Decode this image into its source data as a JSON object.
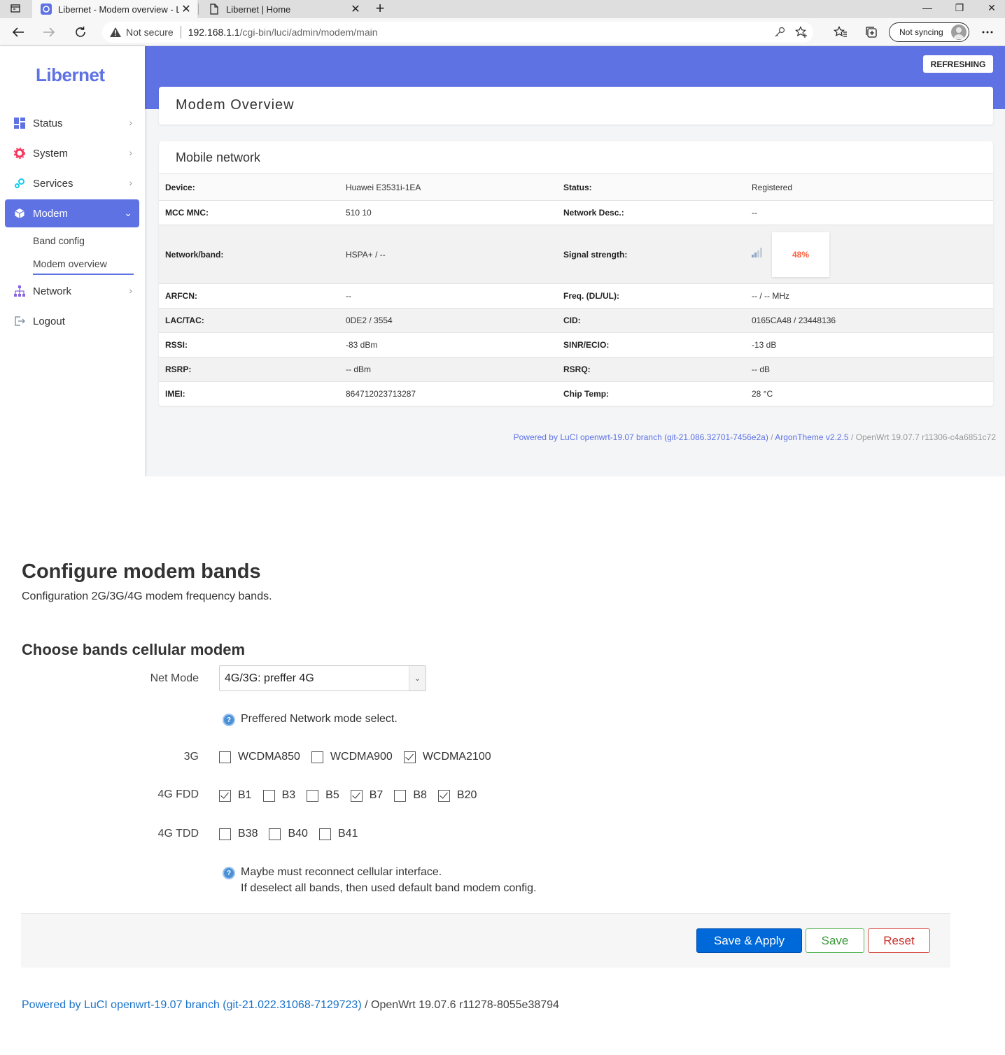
{
  "browser": {
    "tabs": [
      {
        "title": "Libernet - Modem overview - LuCI",
        "active": true
      },
      {
        "title": "Libernet | Home",
        "active": false
      }
    ],
    "address": {
      "security_label": "Not secure",
      "host": "192.168.1.1",
      "path": "/cgi-bin/luci/admin/modem/main"
    },
    "sync_label": "Not syncing"
  },
  "argon": {
    "brand": "Libernet",
    "refresh_label": "REFRESHING",
    "nav": [
      {
        "label": "Status",
        "icon": "dashboard-icon"
      },
      {
        "label": "System",
        "icon": "gear-icon"
      },
      {
        "label": "Services",
        "icon": "services-icon"
      },
      {
        "label": "Modem",
        "icon": "cube-icon",
        "active": true
      },
      {
        "label": "Network",
        "icon": "network-icon"
      },
      {
        "label": "Logout",
        "icon": "logout-icon"
      }
    ],
    "subnav": [
      "Band config",
      "Modem overview"
    ],
    "page_title": "Modem Overview",
    "section_title": "Mobile network",
    "rows": [
      {
        "k1": "Device:",
        "v1": "Huawei E3531i-1EA",
        "k2": "Status:",
        "v2": "Registered"
      },
      {
        "k1": "MCC MNC:",
        "v1": "510 10",
        "k2": "Network Desc.:",
        "v2": "--"
      },
      {
        "k1": "Network/band:",
        "v1": "HSPA+ / --",
        "k2": "Signal strength:",
        "v2": "48%"
      },
      {
        "k1": "ARFCN:",
        "v1": "--",
        "k2": "Freq. (DL/UL):",
        "v2": "-- / -- MHz"
      },
      {
        "k1": "LAC/TAC:",
        "v1": "0DE2 / 3554",
        "k2": "CID:",
        "v2": "0165CA48 / 23448136"
      },
      {
        "k1": "RSSI:",
        "v1": "-83 dBm",
        "k2": "SINR/ECIO:",
        "v2": "-13 dB"
      },
      {
        "k1": "RSRP:",
        "v1": "-- dBm",
        "k2": "RSRQ:",
        "v2": "-- dB"
      },
      {
        "k1": "IMEI:",
        "v1": "864712023713287",
        "k2": "Chip Temp:",
        "v2": "28 °C"
      }
    ],
    "signal_percent": 48,
    "footer": {
      "luci": "Powered by LuCI openwrt-19.07 branch (git-21.086.32701-7456e2a)",
      "sep1": " / ",
      "theme": "ArgonTheme v2.2.5",
      "sep2": " / ",
      "openwrt": "OpenWrt 19.07.7 r11306-c4a6851c72"
    }
  },
  "bands": {
    "title": "Configure modem bands",
    "subtitle": "Configuration 2G/3G/4G modem frequency bands.",
    "section": "Choose bands cellular modem",
    "net_mode_label": "Net Mode",
    "net_mode_value": "4G/3G: preffer 4G",
    "net_mode_hint": "Preffered Network mode select.",
    "groups": [
      {
        "label": "3G",
        "options": [
          {
            "name": "WCDMA850",
            "checked": false
          },
          {
            "name": "WCDMA900",
            "checked": false
          },
          {
            "name": "WCDMA2100",
            "checked": true
          }
        ]
      },
      {
        "label": "4G FDD",
        "options": [
          {
            "name": "B1",
            "checked": true
          },
          {
            "name": "B3",
            "checked": false
          },
          {
            "name": "B5",
            "checked": false
          },
          {
            "name": "B7",
            "checked": true
          },
          {
            "name": "B8",
            "checked": false
          },
          {
            "name": "B20",
            "checked": true
          }
        ]
      },
      {
        "label": "4G TDD",
        "options": [
          {
            "name": "B38",
            "checked": false
          },
          {
            "name": "B40",
            "checked": false
          },
          {
            "name": "B41",
            "checked": false
          }
        ]
      }
    ],
    "hint2_line1": "Maybe must reconnect cellular interface.",
    "hint2_line2": "If deselect all bands, then used default band modem config.",
    "buttons": {
      "apply": "Save & Apply",
      "save": "Save",
      "reset": "Reset"
    },
    "footer": {
      "luci": "Powered by LuCI openwrt-19.07 branch (git-21.022.31068-7129723)",
      "sep": " / ",
      "openwrt": "OpenWrt 19.07.6 r11278-8055e38794"
    }
  }
}
